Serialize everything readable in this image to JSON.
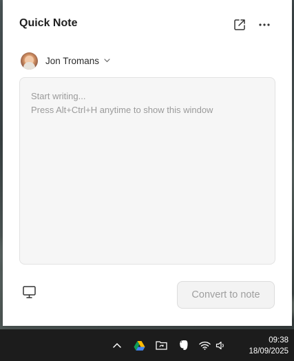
{
  "window": {
    "title": "Quick Note",
    "user_name": "Jon Tromans",
    "editor": {
      "placeholder_line1": "Start writing...",
      "placeholder_line2": "Press Alt+Ctrl+H anytime to show this window"
    },
    "convert_label": "Convert to note"
  },
  "taskbar": {
    "time": "09:38",
    "date": "18/09/2025",
    "tray_icons": [
      "chevron-up-icon",
      "google-drive-icon",
      "folder-sync-icon",
      "evernote-icon",
      "wifi-icon",
      "speaker-icon"
    ]
  },
  "colors": {
    "window_bg": "#ffffff",
    "editor_bg": "#f6f6f6",
    "button_bg": "#f3f3f3",
    "taskbar_bg": "#1c1c1c"
  }
}
